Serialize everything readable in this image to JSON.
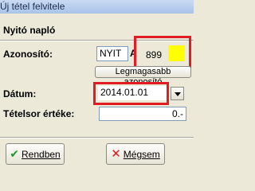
{
  "window": {
    "title": "Új tétel felvitele"
  },
  "section": {
    "title": "Nyitó napló"
  },
  "azonosito": {
    "label": "Azonosító:",
    "prefix": "NYIT",
    "separator": "A",
    "value": "899",
    "highest_button_label": "Legmagasabb azonosító"
  },
  "datum": {
    "label": "Dátum:",
    "value": "2014.01.01"
  },
  "tetelsor": {
    "label": "Tételsor értéke:",
    "value": "0.-"
  },
  "buttons": {
    "ok_label": "Rendben",
    "cancel_label": "Mégsem"
  },
  "colors": {
    "highlight": "#e01d24",
    "marker": "#ffff00",
    "check": "#1f9a2a",
    "cross": "#d11f1f"
  }
}
